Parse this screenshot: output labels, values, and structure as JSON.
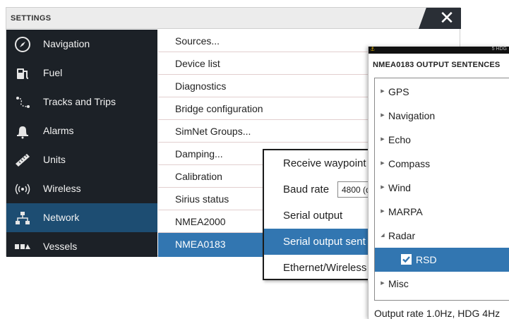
{
  "window": {
    "title": "SETTINGS",
    "close_icon": "close-icon"
  },
  "sidebar": {
    "items": [
      {
        "label": "Navigation",
        "icon": "compass-icon"
      },
      {
        "label": "Fuel",
        "icon": "fuel-pump-icon"
      },
      {
        "label": "Tracks and Trips",
        "icon": "track-icon"
      },
      {
        "label": "Alarms",
        "icon": "bell-icon"
      },
      {
        "label": "Units",
        "icon": "ruler-icon"
      },
      {
        "label": "Wireless",
        "icon": "wireless-icon"
      },
      {
        "label": "Network",
        "icon": "network-icon",
        "selected": true
      },
      {
        "label": "Vessels",
        "icon": "vessels-icon"
      }
    ]
  },
  "network_list": {
    "items": [
      "Sources...",
      "Device list",
      "Diagnostics",
      "Bridge configuration",
      "SimNet Groups...",
      "Damping...",
      "Calibration",
      "Sirius status",
      "NMEA2000",
      "NMEA0183"
    ],
    "selected": "NMEA0183"
  },
  "nmea0183_menu": {
    "items": [
      {
        "label": "Receive waypoint"
      },
      {
        "label": "Baud rate",
        "value": "4800 (d"
      },
      {
        "label": "Serial output"
      },
      {
        "label": "Serial output sent",
        "selected": true
      },
      {
        "label": "Ethernet/Wireless"
      }
    ]
  },
  "output_sentences": {
    "status_clock": "5 HDG",
    "title": "NMEA0183 OUTPUT SENTENCES",
    "groups": [
      {
        "label": "GPS",
        "expanded": false
      },
      {
        "label": "Navigation",
        "expanded": false
      },
      {
        "label": "Echo",
        "expanded": false
      },
      {
        "label": "Compass",
        "expanded": false
      },
      {
        "label": "Wind",
        "expanded": false
      },
      {
        "label": "MARPA",
        "expanded": false
      },
      {
        "label": "Radar",
        "expanded": true
      },
      {
        "label": "RSD",
        "child": true,
        "checked": true,
        "selected": true
      },
      {
        "label": "Misc",
        "expanded": false
      }
    ],
    "footer": "Output rate 1.0Hz, HDG 4Hz"
  },
  "colors": {
    "sidebar_bg": "#1c2127",
    "selection": "#3276b1",
    "sidebar_selected": "#1d4d72"
  }
}
